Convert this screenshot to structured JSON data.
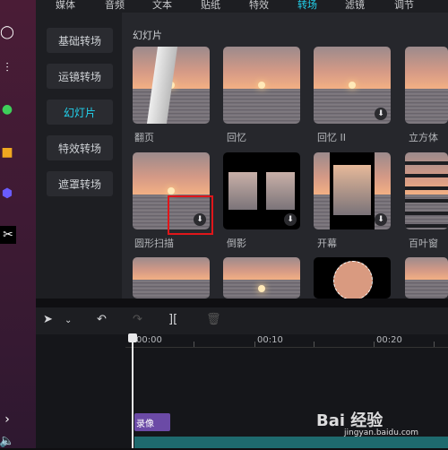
{
  "top_tabs": [
    "媒体",
    "音频",
    "文本",
    "贴纸",
    "特效",
    "转场",
    "滤镜",
    "调节"
  ],
  "active_tab": "转场",
  "categories": [
    "基础转场",
    "运镜转场",
    "幻灯片",
    "特效转场",
    "遮罩转场"
  ],
  "active_category": "幻灯片",
  "section_title": "幻灯片",
  "thumbs": [
    {
      "label": "翻页"
    },
    {
      "label": "回忆"
    },
    {
      "label": "回忆 II"
    },
    {
      "label": "立方体"
    },
    {
      "label": "圆形扫描"
    },
    {
      "label": "倒影"
    },
    {
      "label": "开幕"
    },
    {
      "label": "百叶窗"
    },
    {
      "label": ""
    },
    {
      "label": ""
    },
    {
      "label": ""
    },
    {
      "label": ""
    }
  ],
  "ruler": [
    "00:00",
    "00:10",
    "00:20"
  ],
  "clip_label": "录像",
  "watermark": "Bai 经验",
  "watermark_url": "jingyan.baidu.com",
  "accent": "#22d3ee",
  "highlight_color": "#e0161a"
}
